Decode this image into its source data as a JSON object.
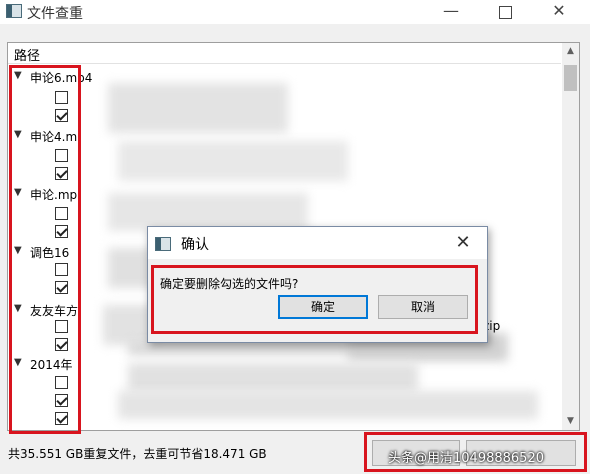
{
  "window": {
    "title": "文件查重"
  },
  "tree": {
    "column_header": "路径",
    "groups": [
      {
        "label": "申论6.mp4",
        "files": [
          {
            "checked": false
          },
          {
            "checked": true
          }
        ]
      },
      {
        "label": "申论4.m",
        "files": [
          {
            "checked": false
          },
          {
            "checked": true
          }
        ]
      },
      {
        "label": "申论.mp",
        "files": [
          {
            "checked": false
          },
          {
            "checked": true
          }
        ]
      },
      {
        "label": "调色16",
        "files": [
          {
            "checked": false
          },
          {
            "checked": true
          }
        ]
      },
      {
        "label": "友友车方",
        "files": [
          {
            "checked": false
          },
          {
            "checked": true
          }
        ]
      },
      {
        "label": "2014年",
        "files": [
          {
            "checked": false
          },
          {
            "checked": true
          },
          {
            "checked": true
          }
        ]
      }
    ],
    "visible_fragment": "zip"
  },
  "dialog": {
    "title": "确认",
    "message": "确定要删除勾选的文件吗?",
    "ok_label": "确定",
    "cancel_label": "取消"
  },
  "status": {
    "summary": "共35.551 GB重复文件，去重可节省18.471 GB"
  },
  "watermark": "头条@用清10498886520",
  "colors": {
    "highlight": "#d8141e",
    "accent": "#0078d7"
  }
}
